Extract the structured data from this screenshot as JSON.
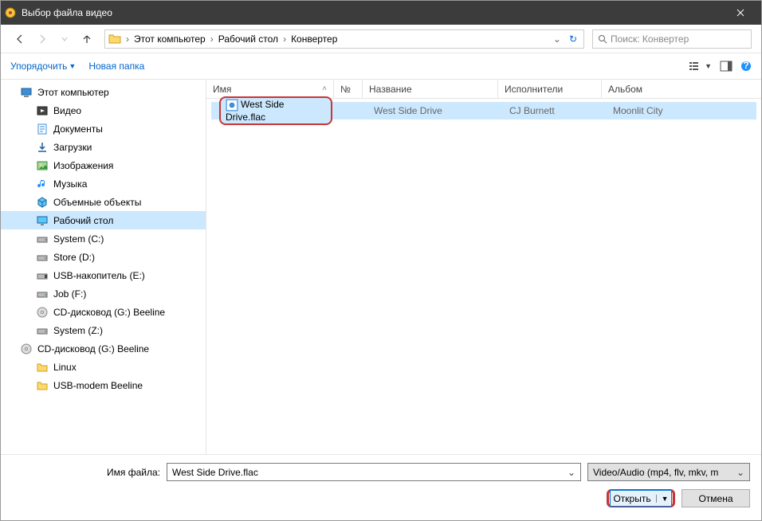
{
  "window": {
    "title": "Выбор файла видео"
  },
  "breadcrumb": {
    "items": [
      "Этот компьютер",
      "Рабочий стол",
      "Конвертер"
    ]
  },
  "search": {
    "placeholder": "Поиск: Конвертер"
  },
  "toolbar": {
    "organize": "Упорядочить",
    "newfolder": "Новая папка"
  },
  "tree": {
    "items": [
      {
        "label": "Этот компьютер",
        "level": 1,
        "icon": "pc"
      },
      {
        "label": "Видео",
        "level": 2,
        "icon": "video"
      },
      {
        "label": "Документы",
        "level": 2,
        "icon": "docs"
      },
      {
        "label": "Загрузки",
        "level": 2,
        "icon": "downloads"
      },
      {
        "label": "Изображения",
        "level": 2,
        "icon": "pictures"
      },
      {
        "label": "Музыка",
        "level": 2,
        "icon": "music"
      },
      {
        "label": "Объемные объекты",
        "level": 2,
        "icon": "3d"
      },
      {
        "label": "Рабочий стол",
        "level": 2,
        "icon": "desktop",
        "selected": true
      },
      {
        "label": "System (C:)",
        "level": 2,
        "icon": "drive"
      },
      {
        "label": "Store (D:)",
        "level": 2,
        "icon": "drive"
      },
      {
        "label": "USB-накопитель (E:)",
        "level": 2,
        "icon": "usb"
      },
      {
        "label": "Job (F:)",
        "level": 2,
        "icon": "drive"
      },
      {
        "label": "CD-дисковод (G:) Beeline",
        "level": 2,
        "icon": "cd"
      },
      {
        "label": "System (Z:)",
        "level": 2,
        "icon": "drive"
      },
      {
        "label": "CD-дисковод (G:) Beeline",
        "level": 1,
        "icon": "cd"
      },
      {
        "label": "Linux",
        "level": 2,
        "icon": "folder"
      },
      {
        "label": "USB-modem Beeline",
        "level": 2,
        "icon": "folder"
      }
    ]
  },
  "columns": {
    "name": "Имя",
    "num": "№",
    "title": "Название",
    "artist": "Исполнители",
    "album": "Альбом"
  },
  "files": [
    {
      "name": "West Side Drive.flac",
      "title": "West Side Drive",
      "artist": "CJ Burnett",
      "album": "Moonlit City"
    }
  ],
  "footer": {
    "label": "Имя файла:",
    "filename": "West Side Drive.flac",
    "filter": "Video/Audio (mp4, flv, mkv, m",
    "open": "Открыть",
    "cancel": "Отмена"
  }
}
